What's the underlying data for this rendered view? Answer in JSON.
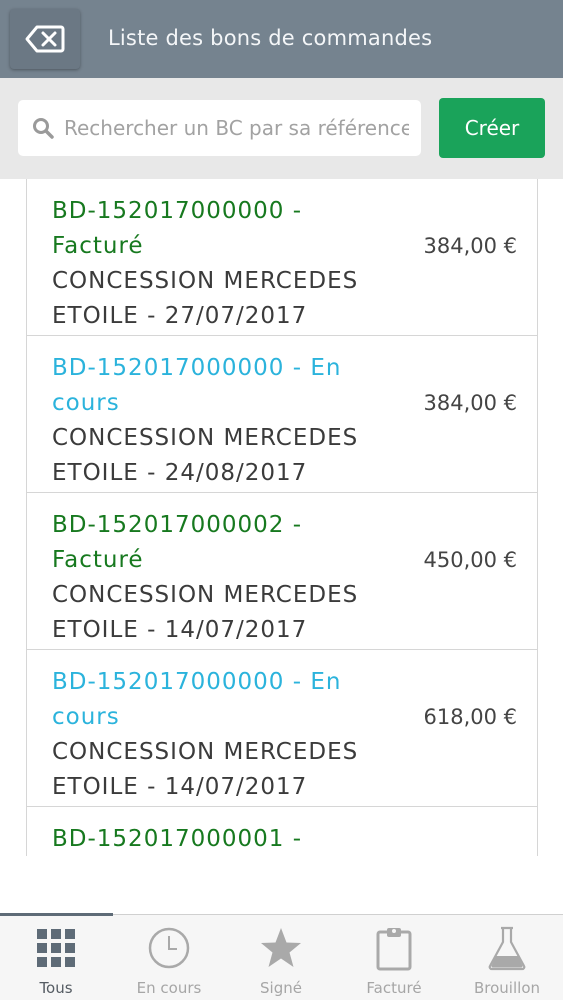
{
  "header": {
    "title": "Liste des bons de commandes",
    "back_icon": "backspace-icon"
  },
  "search": {
    "placeholder": "Rechercher un BC par sa référence",
    "value": "",
    "create_label": "Créer"
  },
  "colors": {
    "header_bg": "#75838f",
    "create_button": "#1aa35a",
    "status_facture": "#17791f",
    "status_en_cours": "#2bb3dc"
  },
  "orders": [
    {
      "reference": "BD-152017000000 - ",
      "status": "Facturé",
      "status_type": "facture",
      "dealer": "CONCESSION MERCEDES ETOILE",
      "date": "27/07/2017",
      "amount": "384,00 €"
    },
    {
      "reference": "BD-152017000000 - ",
      "status": "En cours",
      "status_type": "en_cours",
      "dealer": "CONCESSION MERCEDES ETOILE",
      "date": "24/08/2017",
      "amount": "384,00 €"
    },
    {
      "reference": "BD-152017000002 - ",
      "status": "Facturé",
      "status_type": "facture",
      "dealer": "CONCESSION MERCEDES ETOILE",
      "date": "14/07/2017",
      "amount": "450,00 €"
    },
    {
      "reference": "BD-152017000000 - ",
      "status": "En cours",
      "status_type": "en_cours",
      "dealer": "CONCESSION MERCEDES ETOILE",
      "date": "14/07/2017",
      "amount": "618,00 €"
    },
    {
      "reference": "BD-152017000001 - ",
      "status": "",
      "status_type": "facture",
      "dealer": "",
      "date": "",
      "amount": ""
    }
  ],
  "tabs": [
    {
      "label": "Tous",
      "icon": "grid-icon",
      "active": true
    },
    {
      "label": "En cours",
      "icon": "clock-icon",
      "active": false
    },
    {
      "label": "Signé",
      "icon": "star-icon",
      "active": false
    },
    {
      "label": "Facturé",
      "icon": "clipboard-icon",
      "active": false
    },
    {
      "label": "Brouillon",
      "icon": "flask-icon",
      "active": false
    }
  ]
}
